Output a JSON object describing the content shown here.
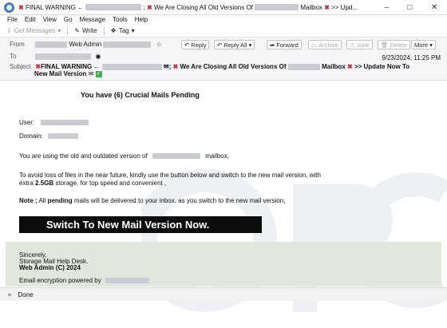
{
  "window": {
    "title_prefix": "FINAL WARNING ←",
    "title_mid": "; ",
    "title_rest": " We Are Closing All Old Versions Of",
    "title_suffix": "Mailbox",
    "title_end": ">> Upd..."
  },
  "menu": [
    "File",
    "Edit",
    "View",
    "Go",
    "Message",
    "Tools",
    "Help"
  ],
  "toolbar": {
    "get_messages": "Get Messages",
    "write": "Write",
    "tag": "Tag"
  },
  "header": {
    "from_label": "From",
    "from_name": "Web Admin",
    "to_label": "To",
    "subject_label": "Subject",
    "subject_line1_a": "FINAL WARNING ←",
    "subject_line1_b": "; ",
    "subject_line1_c": " We Are Closing All Old Versions Of",
    "subject_line1_d": "Mailbox",
    "subject_line1_e": ">> Update Now To",
    "subject_line2": "New Mail Version",
    "date": "9/23/2024, 11:25 PM",
    "actions": {
      "reply": "Reply",
      "reply_all": "Reply All",
      "forward": "Forward",
      "archive": "Archive",
      "junk": "Junk",
      "delete": "Delete",
      "more": "More"
    }
  },
  "email": {
    "headline": "You have (6)  Crucial Mails Pending",
    "user_label": "User:",
    "domain_label": "Domain:",
    "old_version_a": "You are using the old and outdated version of",
    "old_version_b": "mailbox,",
    "avoid_a": "To avoid loss of files in the near future, kindly use the button below and switch to the new mail version, with",
    "avoid_b_pre": "extra ",
    "avoid_b_bold": "2.5GB",
    "avoid_b_post": " storage, for top speed and convenient ,",
    "note_bold": "Note ;",
    "note_mid": " All  ",
    "note_pending": "pending",
    "note_post": "  mails will be delivered to your inbox, as you switch to the new mail version,",
    "cta": "Switch To New Mail Version Now.",
    "sincerely": "Sincerely,",
    "desk": "Storage Mail Help Desk.",
    "webadmin": "Web Admin (C) 2024",
    "encryption": "Email encryption powered by"
  },
  "status": {
    "text": "Done"
  }
}
